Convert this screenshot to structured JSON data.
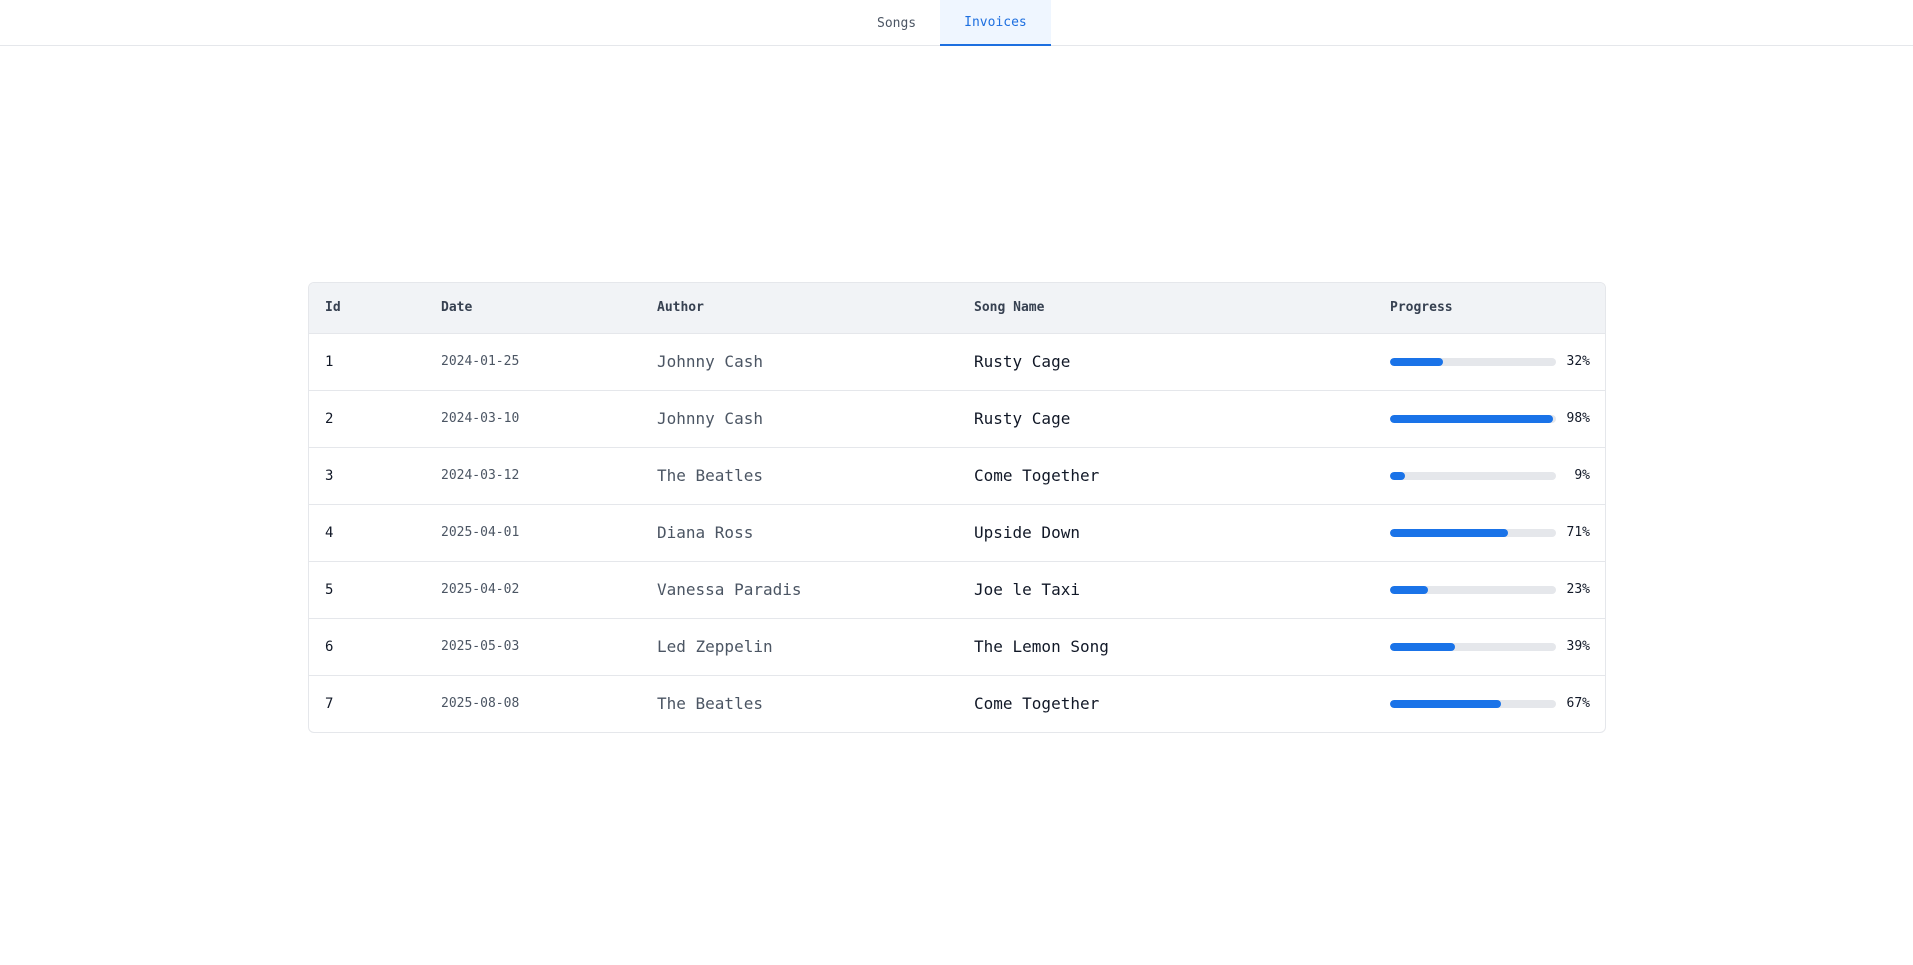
{
  "nav": {
    "tabs": [
      {
        "label": "Songs",
        "active": false
      },
      {
        "label": "Invoices",
        "active": true
      }
    ]
  },
  "table": {
    "headers": {
      "id": "Id",
      "date": "Date",
      "author": "Author",
      "song": "Song Name",
      "progress": "Progress"
    },
    "rows": [
      {
        "id": "1",
        "date": "2024-01-25",
        "author": "Johnny Cash",
        "song": "Rusty Cage",
        "progress": 32,
        "progress_label": "32%"
      },
      {
        "id": "2",
        "date": "2024-03-10",
        "author": "Johnny Cash",
        "song": "Rusty Cage",
        "progress": 98,
        "progress_label": "98%"
      },
      {
        "id": "3",
        "date": "2024-03-12",
        "author": "The Beatles",
        "song": "Come Together",
        "progress": 9,
        "progress_label": "9%"
      },
      {
        "id": "4",
        "date": "2025-04-01",
        "author": "Diana Ross",
        "song": "Upside Down",
        "progress": 71,
        "progress_label": "71%"
      },
      {
        "id": "5",
        "date": "2025-04-02",
        "author": "Vanessa Paradis",
        "song": "Joe le Taxi",
        "progress": 23,
        "progress_label": "23%"
      },
      {
        "id": "6",
        "date": "2025-05-03",
        "author": "Led Zeppelin",
        "song": "The Lemon Song",
        "progress": 39,
        "progress_label": "39%"
      },
      {
        "id": "7",
        "date": "2025-08-08",
        "author": "The Beatles",
        "song": "Come Together",
        "progress": 67,
        "progress_label": "67%"
      }
    ]
  },
  "colors": {
    "accent": "#1a73e8",
    "track": "#e5e7eb",
    "header_bg": "#f1f3f6",
    "active_tab_bg": "#eff6ff"
  }
}
